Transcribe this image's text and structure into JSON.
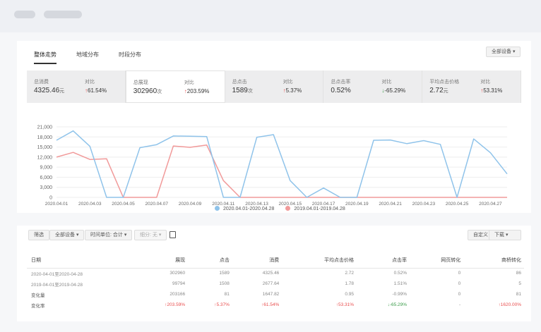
{
  "tabs": [
    {
      "label": "整体走势"
    },
    {
      "label": "地域分布"
    },
    {
      "label": "时段分布"
    }
  ],
  "device_select": "全部设备",
  "metrics": [
    {
      "label": "总消费",
      "value": "4325.46",
      "unit": "元",
      "compare_label": "对比",
      "change": "61.54%",
      "direction": "up"
    },
    {
      "label": "总展现",
      "value": "302960",
      "unit": "次",
      "compare_label": "对比",
      "change": "203.59%",
      "direction": "up"
    },
    {
      "label": "总点击",
      "value": "1589",
      "unit": "次",
      "compare_label": "对比",
      "change": "5.37%",
      "direction": "up"
    },
    {
      "label": "总点击率",
      "value": "0.52%",
      "unit": "",
      "compare_label": "对比",
      "change": "-65.29%",
      "direction": "down"
    },
    {
      "label": "平均点击价格",
      "value": "2.72",
      "unit": "元",
      "compare_label": "对比",
      "change": "53.31%",
      "direction": "up"
    }
  ],
  "chart_data": {
    "type": "line",
    "x": [
      "2020.04.01",
      "2020.04.02",
      "2020.04.03",
      "2020.04.04",
      "2020.04.05",
      "2020.04.06",
      "2020.04.07",
      "2020.04.08",
      "2020.04.09",
      "2020.04.10",
      "2020.04.11",
      "2020.04.12",
      "2020.04.13",
      "2020.04.14",
      "2020.04.15",
      "2020.04.16",
      "2020.04.17",
      "2020.04.18",
      "2020.04.19",
      "2020.04.20",
      "2020.04.21",
      "2020.04.22",
      "2020.04.23",
      "2020.04.24",
      "2020.04.25",
      "2020.04.26",
      "2020.04.27",
      "2020.04.28"
    ],
    "tick_labels": [
      "2020.04.01",
      "2020.04.03",
      "2020.04.05",
      "2020.04.07",
      "2020.04.09",
      "2020.04.11",
      "2020.04.13",
      "2020.04.15",
      "2020.04.17",
      "2020.04.19",
      "2020.04.21",
      "2020.04.23",
      "2020.04.25",
      "2020.04.27"
    ],
    "yticks": [
      "0",
      "3,000",
      "6,000",
      "9,000",
      "12,000",
      "15,000",
      "18,000",
      "21,000"
    ],
    "ylim": [
      0,
      21000
    ],
    "grid": true,
    "legend_position": "bottom",
    "series": [
      {
        "name": "2020.04.01-2020.04.28",
        "color": "#8fc3ea",
        "values": [
          17000,
          19800,
          15200,
          0,
          0,
          14800,
          15700,
          18300,
          18200,
          18100,
          0,
          0,
          17900,
          18700,
          5000,
          0,
          2800,
          0,
          0,
          17000,
          17100,
          16000,
          16900,
          15800,
          0,
          17400,
          13300,
          7000
        ]
      },
      {
        "name": "2019.04.01-2019.04.28",
        "color": "#f19a9a",
        "values": [
          12000,
          13400,
          11300,
          11500,
          0,
          0,
          0,
          15300,
          14900,
          15600,
          5000,
          0,
          0,
          0,
          0,
          0,
          0,
          0,
          0,
          0,
          0,
          0,
          0,
          0,
          0,
          0,
          0,
          0
        ]
      }
    ]
  },
  "toolbar": {
    "filter": "筛选",
    "device": "全部设备",
    "time_unit": "时间单位: 合计",
    "disabled_select": "细分: 无",
    "customize": "自定义",
    "download": "下载"
  },
  "table": {
    "headers": [
      "日期",
      "展现",
      "点击",
      "消费",
      "平均点击价格",
      "点击率",
      "网页转化",
      "商桥转化"
    ],
    "rows": [
      {
        "cells": [
          "2020-04-01至2020-04-28",
          "302960",
          "1589",
          "4325.46",
          "2.72",
          "0.52%",
          "0",
          "86"
        ],
        "style": "plain"
      },
      {
        "cells": [
          "2019-04-01至2019-04-28",
          "99794",
          "1508",
          "2677.64",
          "1.78",
          "1.51%",
          "0",
          "5"
        ],
        "style": "plain"
      },
      {
        "cells": [
          "变化量",
          "203166",
          "81",
          "1647.82",
          "0.95",
          "-0.99%",
          "0",
          "81"
        ],
        "style": "plain"
      },
      {
        "cells": [
          "变化率",
          "↑203.59%",
          "↑5.37%",
          "↑61.54%",
          "↑53.31%",
          "↓-65.29%",
          "-",
          "↑1620.00%"
        ],
        "style": "rate"
      }
    ]
  }
}
